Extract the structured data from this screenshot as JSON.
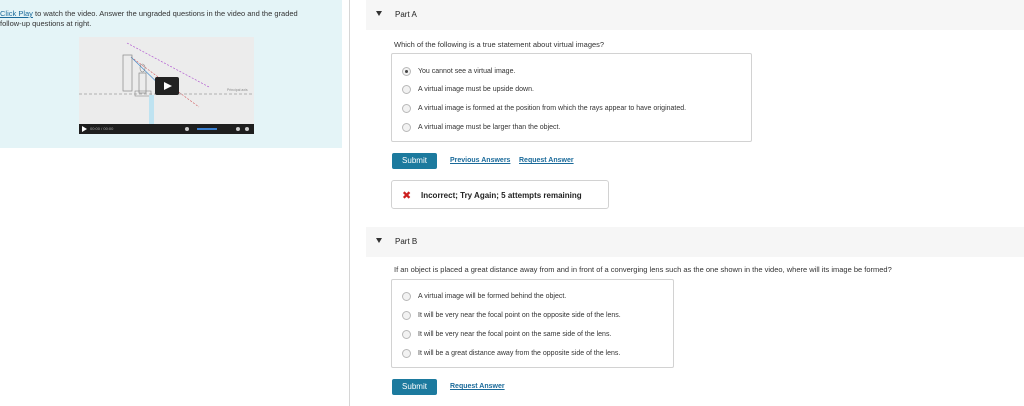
{
  "left_panel": {
    "intro_link": "Click Play",
    "intro_text_1": " to watch the video. Answer the ungraded questions in the video and the graded",
    "intro_text_2": "follow-up questions at right.",
    "video": {
      "axis_label": "Principal axis",
      "time": "00:00 / 00:00"
    }
  },
  "part_a": {
    "title": "Part A",
    "question": "Which of the following is a true statement about virtual images?",
    "choices": [
      "You cannot see a virtual image.",
      "A virtual image must be upside down.",
      "A virtual image is formed at the position from which the rays appear to have originated.",
      "A virtual image must be larger than the object."
    ],
    "selected_index": 0,
    "submit_label": "Submit",
    "previous_answers_label": "Previous Answers",
    "request_answer_label": "Request Answer",
    "feedback": "Incorrect; Try Again; 5 attempts remaining"
  },
  "part_b": {
    "title": "Part B",
    "question": "If an object is placed a great distance away from and in front of a converging lens such as the one shown in the video, where will its image be formed?",
    "choices": [
      "A virtual image will be formed behind the object.",
      "It will be very near the focal point on the opposite side of the lens.",
      "It will be very near the focal point on the same side of the lens.",
      "It will be a great distance away from the opposite side of the lens."
    ],
    "submit_label": "Submit",
    "request_answer_label": "Request Answer"
  },
  "colors": {
    "left_panel_bg": "#e4f4f7",
    "submit_bg": "#1c7a9e",
    "link": "#1a6a9a",
    "error": "#cc1f1f"
  }
}
